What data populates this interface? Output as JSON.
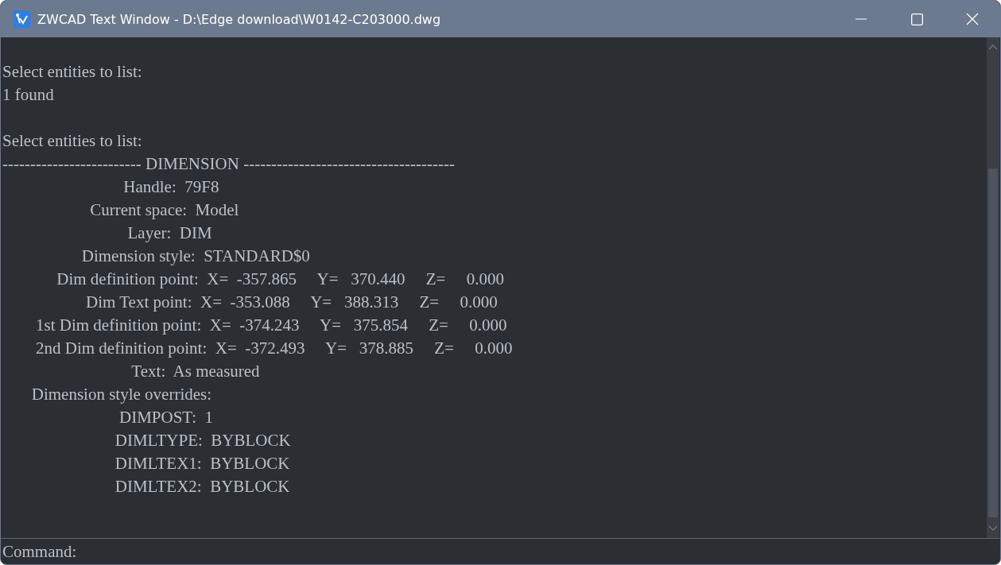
{
  "window": {
    "title": "ZWCAD Text Window - D:\\Edge download\\W0142-C203000.dwg"
  },
  "lines": [
    {
      "kind": "blank"
    },
    {
      "kind": "text",
      "text": "Select entities to list:"
    },
    {
      "kind": "text",
      "text": "1 found"
    },
    {
      "kind": "blank"
    },
    {
      "kind": "text",
      "text": "Select entities to list:"
    },
    {
      "kind": "text",
      "text": "------------------------- DIMENSION --------------------------------------"
    },
    {
      "kind": "text",
      "text": "                             Handle:  79F8"
    },
    {
      "kind": "text",
      "text": "                     Current space:  Model"
    },
    {
      "kind": "text",
      "text": "                              Layer:  DIM"
    },
    {
      "kind": "text",
      "text": "                   Dimension style:  STANDARD$0"
    },
    {
      "kind": "text",
      "text": "             Dim definition point:  X=  -357.865     Y=   370.440     Z=     0.000"
    },
    {
      "kind": "text",
      "text": "                    Dim Text point:  X=  -353.088     Y=   388.313     Z=     0.000"
    },
    {
      "kind": "text",
      "text": "        1st Dim definition point:  X=  -374.243     Y=   375.854     Z=     0.000"
    },
    {
      "kind": "text",
      "text": "        2nd Dim definition point:  X=  -372.493     Y=   378.885     Z=     0.000"
    },
    {
      "kind": "text",
      "text": "                               Text:  As measured"
    },
    {
      "kind": "text",
      "text": "       Dimension style overrides:"
    },
    {
      "kind": "text",
      "text": "                            DIMPOST:  1"
    },
    {
      "kind": "text",
      "text": "                           DIMLTYPE:  BYBLOCK"
    },
    {
      "kind": "text",
      "text": "                           DIMLTEX1:  BYBLOCK"
    },
    {
      "kind": "text",
      "text": "                           DIMLTEX2:  BYBLOCK"
    }
  ],
  "command": {
    "prompt": "Command:"
  }
}
